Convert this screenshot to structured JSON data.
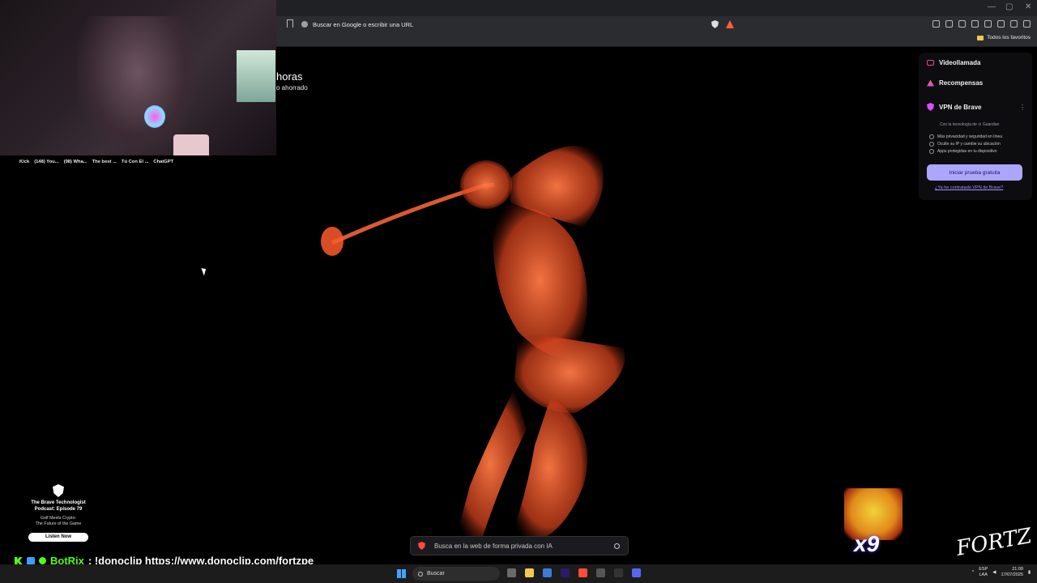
{
  "browser": {
    "address_placeholder": "Buscar en Google o escribir una URL",
    "bookmarks_label": "Todos los favoritos",
    "window_controls": [
      "—",
      "▢",
      "✕"
    ]
  },
  "shortcuts": [
    "Kick",
    "(148) You...",
    "(98) Wha...",
    "The best ...",
    "Tú Con El ...",
    "ChatGPT"
  ],
  "stats": {
    "big": "horas",
    "small": "o ahorrado"
  },
  "panel": {
    "videocall": "Videollamada",
    "rewards": "Recompensas",
    "vpn_title": "VPN de Brave",
    "vpn_tech": "Con la tecnología de ⊙ Guardian",
    "vpn_features": [
      "Más privacidad y seguridad en línea",
      "Oculte su IP y cambie su ubicación",
      "Apps protegidas en tu dispositivo"
    ],
    "trial_button": "Iniciar prueba gratuita",
    "vpn_link": "¿Ya he contratado VPN de Brave?",
    "accent": "#aca6ff"
  },
  "ai_search": {
    "placeholder": "Busca en la web de forma privada con IA"
  },
  "podcast": {
    "title_line1": "The Brave Technologist",
    "title_line2": "Podcast: Episode 79",
    "subtitle_line1": "Golf Meets Crypto:",
    "subtitle_line2": "The Future of the Game",
    "button": "Listen Now"
  },
  "chat": {
    "user": "BotRix",
    "message": ": !donoclip https://www.donoclip.com/fortzpe_"
  },
  "overlay": {
    "multiplier": "x9",
    "signature": "FORTZ"
  },
  "taskbar": {
    "search_label": "Buscar",
    "lang_line1": "ESP",
    "lang_line2": "LAA",
    "time": "21:09",
    "date": "17/07/2025"
  }
}
